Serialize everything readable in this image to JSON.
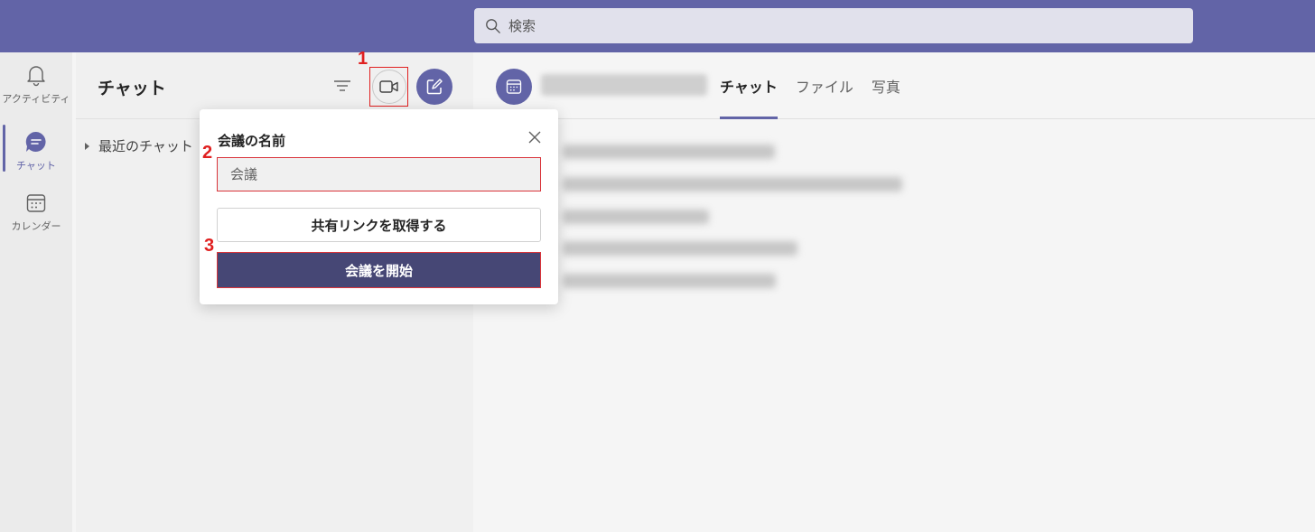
{
  "search": {
    "placeholder": "検索"
  },
  "rail": {
    "items": [
      {
        "label": "アクティビティ",
        "icon": "bell-icon"
      },
      {
        "label": "チャット",
        "icon": "chat-icon"
      },
      {
        "label": "カレンダー",
        "icon": "calendar-icon"
      }
    ]
  },
  "chatlist": {
    "title": "チャット",
    "recent_label": "最近のチャット"
  },
  "main": {
    "tabs": [
      {
        "label": "チャット"
      },
      {
        "label": "ファイル"
      },
      {
        "label": "写真"
      }
    ]
  },
  "dialog": {
    "title": "会議の名前",
    "input_placeholder": "会議",
    "share_link_label": "共有リンクを取得する",
    "start_label": "会議を開始"
  },
  "annotations": {
    "step1": "1",
    "step2": "2",
    "step3": "3"
  },
  "colors": {
    "brand": "#6264a7",
    "highlight": "#e02020",
    "start_button": "#464775"
  }
}
